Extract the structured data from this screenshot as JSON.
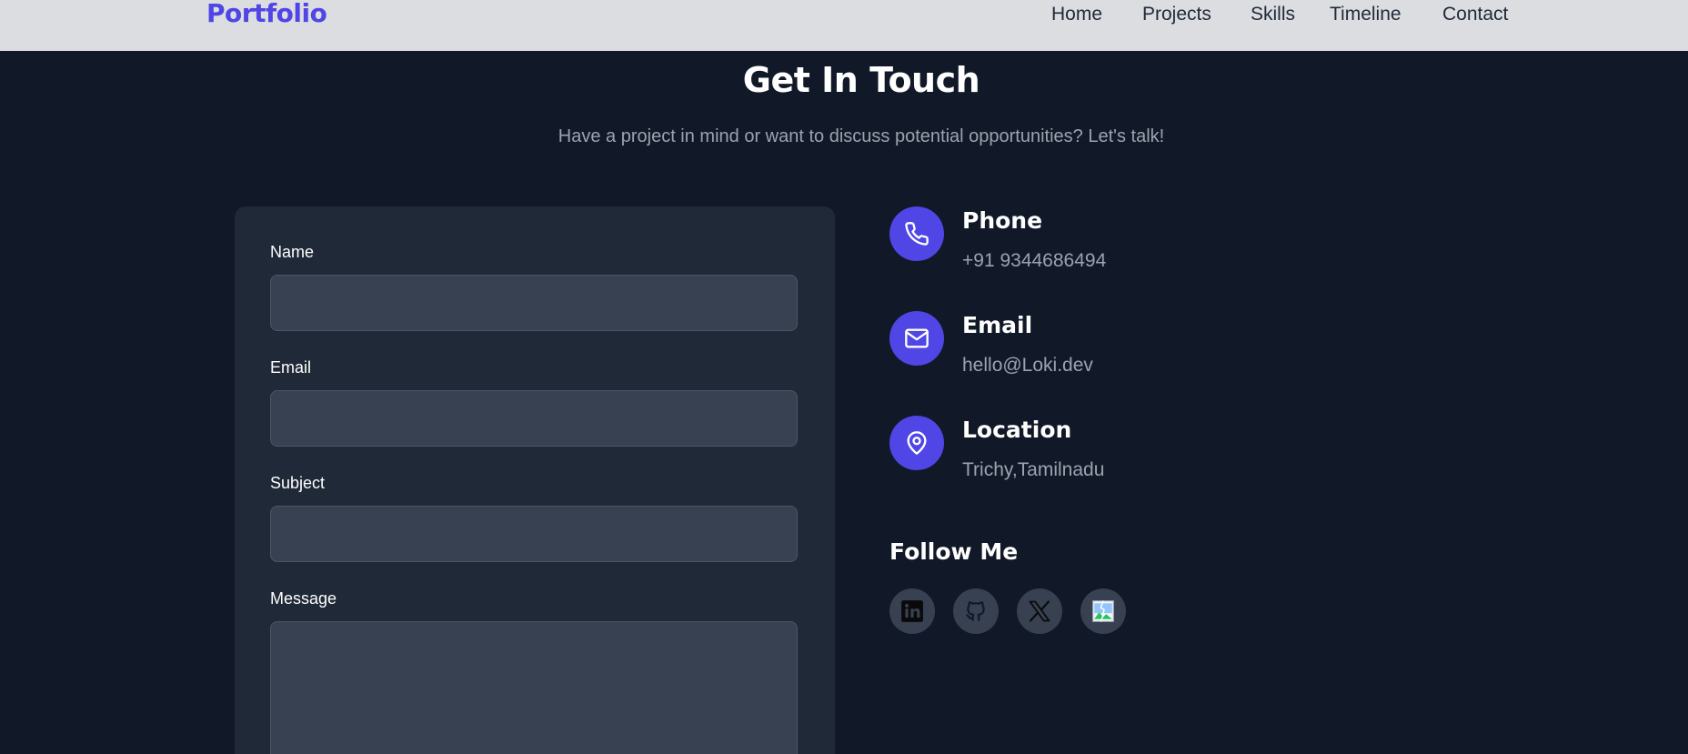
{
  "nav": {
    "brand": "Portfolio",
    "links": [
      "Home",
      "Projects",
      "Skills",
      "Timeline",
      "Contact"
    ]
  },
  "section": {
    "title": "Get In Touch",
    "subtitle": "Have a project in mind or want to discuss potential opportunities? Let's talk!"
  },
  "form": {
    "name_label": "Name",
    "email_label": "Email",
    "subject_label": "Subject",
    "message_label": "Message",
    "name_value": "",
    "email_value": "",
    "subject_value": "",
    "message_value": ""
  },
  "contact": {
    "items": [
      {
        "title": "Phone",
        "value": "+91 9344686494",
        "icon": "phone-icon"
      },
      {
        "title": "Email",
        "value": "hello@Loki.dev",
        "icon": "mail-icon"
      },
      {
        "title": "Location",
        "value": "Trichy,Tamilnadu",
        "icon": "map-pin-icon"
      }
    ]
  },
  "social": {
    "title": "Follow Me",
    "links": [
      "linkedin-icon",
      "github-icon",
      "x-icon",
      "broken-image-icon"
    ]
  },
  "colors": {
    "accent": "#4f46e5",
    "background": "#111827",
    "card": "#1f2937",
    "input": "#374151",
    "navbar": "#dcdde1"
  }
}
